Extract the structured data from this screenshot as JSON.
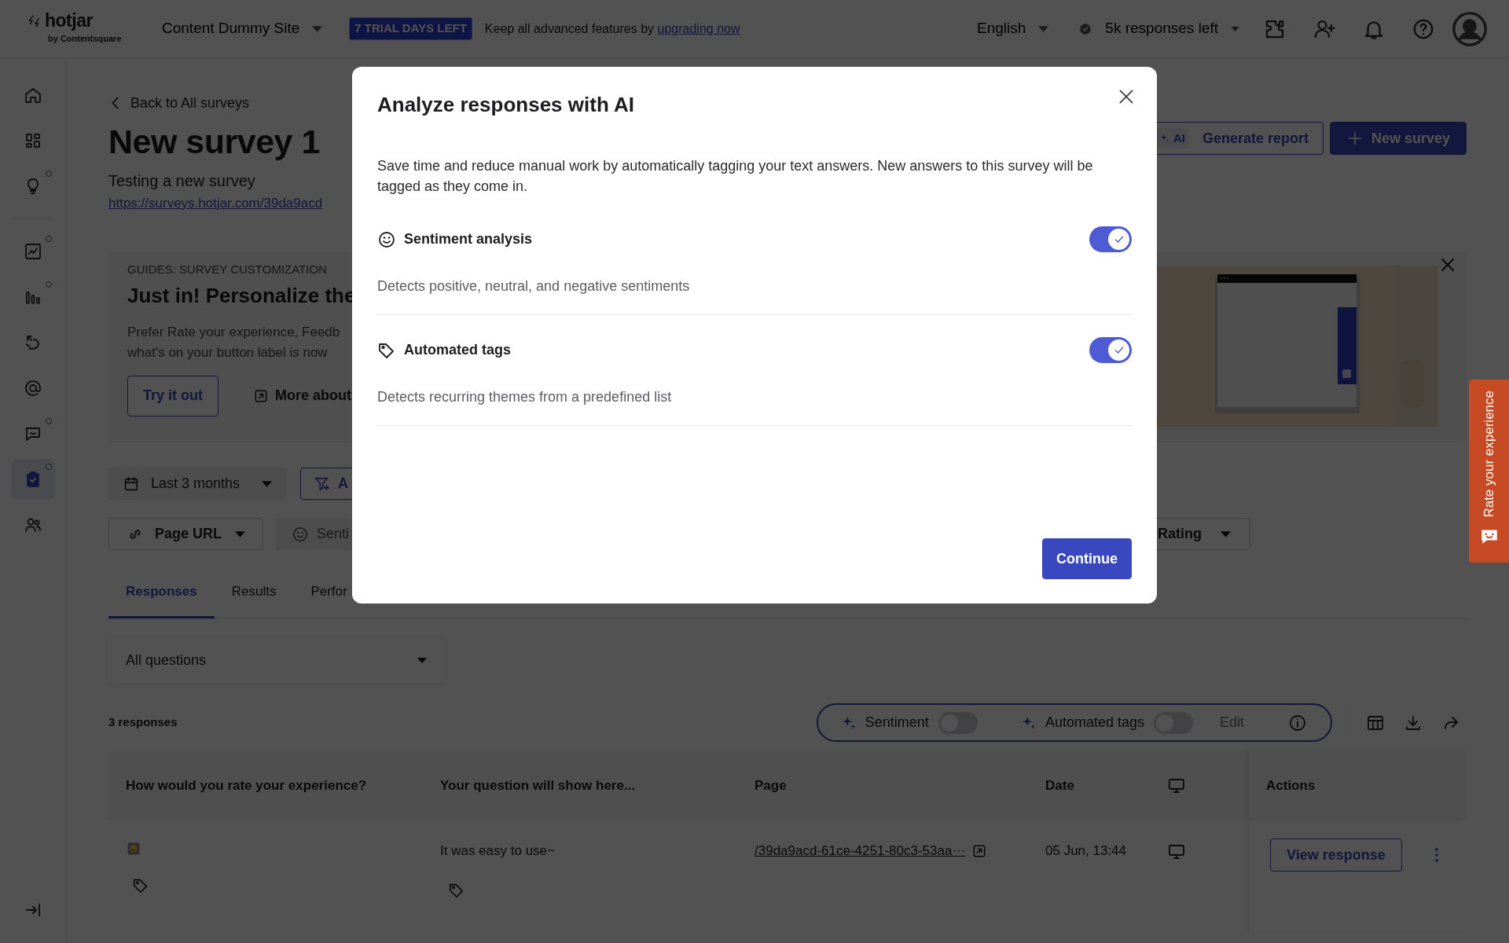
{
  "topbar": {
    "logo": "hotjar",
    "logo_sub": "by Contentsquare",
    "site": "Content Dummy Site",
    "trial_badge": "7 TRIAL DAYS LEFT",
    "upgrade_text": "Keep all advanced features by",
    "upgrade_link": "upgrading now",
    "language": "English",
    "responses_left": "5k responses left"
  },
  "sidebar": {
    "items": [
      {
        "selected": false,
        "dot": false
      },
      {
        "selected": false,
        "dot": false
      },
      {
        "selected": false,
        "dot": true
      },
      {
        "selected": false,
        "dot": true
      },
      {
        "selected": false,
        "dot": true
      },
      {
        "selected": false,
        "dot": false
      },
      {
        "selected": false,
        "dot": false
      },
      {
        "selected": false,
        "dot": true
      },
      {
        "selected": true,
        "dot": true
      },
      {
        "selected": false,
        "dot": false
      }
    ]
  },
  "page": {
    "back_link": "Back to All surveys",
    "title": "New survey 1",
    "subtitle": "Testing a new survey",
    "url": "https://surveys.hotjar.com/39da9acd",
    "ai_badge": "AI",
    "generate_button": "Generate report",
    "new_button": "New survey"
  },
  "guide": {
    "eyebrow": "GUIDES: SURVEY CUSTOMIZATION",
    "title": "Just in! Personalize the",
    "body": [
      "Prefer Rate your experience, Feedb",
      "what's on your button label is now"
    ],
    "try_button": "Try it out",
    "more_link": "More about"
  },
  "filters": [
    {
      "kind": "date",
      "label": "Last 3 months"
    },
    {
      "kind": "add",
      "label": "A"
    }
  ],
  "segments": [
    {
      "kind": "link",
      "label": "Page URL"
    },
    {
      "kind": "sentiment",
      "label": "Senti"
    },
    {
      "kind": "rating",
      "label": "Rating"
    }
  ],
  "tabs": [
    {
      "label": "Responses",
      "selected": true
    },
    {
      "label": "Results",
      "selected": false
    },
    {
      "label": "Perfor",
      "selected": false
    }
  ],
  "question_select": "All questions",
  "response_count": "3 responses",
  "ai_toolbar": {
    "sentiment": {
      "label": "Sentiment",
      "on": false
    },
    "tags": {
      "label": "Automated tags",
      "on": false
    },
    "edit": {
      "label": "Edit",
      "disabled": true
    }
  },
  "table": {
    "columns": [
      {
        "kind": "text",
        "label": "How would you rate your experience?"
      },
      {
        "kind": "text",
        "label": "Your question will show here..."
      },
      {
        "kind": "text",
        "label": "Page"
      },
      {
        "kind": "text",
        "label": "Date"
      },
      {
        "kind": "device"
      },
      {
        "kind": "text",
        "label": "Actions"
      }
    ],
    "rows": [
      {
        "answer": "It was easy to use~",
        "page": "/39da9acd-61ce-4251-80c3-53aa···",
        "date": "05 Jun, 13:44",
        "action": "View response"
      }
    ]
  },
  "modal": {
    "title": "Analyze responses with AI",
    "description": "Save time and reduce manual work by automatically tagging your text answers. New answers to this survey will be tagged as they come in.",
    "options": [
      {
        "kind": "sentiment",
        "label": "Sentiment analysis",
        "description": "Detects positive, neutral, and negative sentiments",
        "on": true
      },
      {
        "kind": "tags",
        "label": "Automated tags",
        "description": "Detects recurring themes from a predefined list",
        "on": true
      }
    ],
    "continue_button": "Continue"
  },
  "feedback_tab": "Rate your experience"
}
